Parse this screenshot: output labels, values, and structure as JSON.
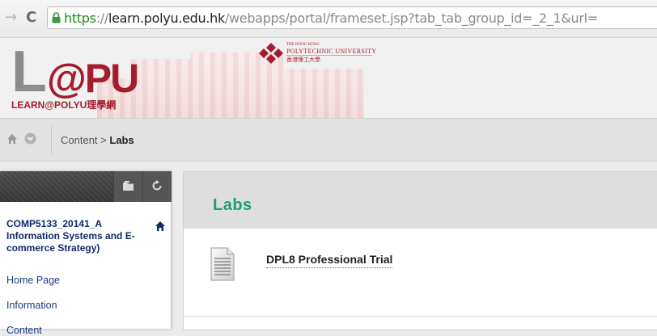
{
  "browser": {
    "back_icon": "arrow-right-icon",
    "reload_icon": "reload-icon",
    "url_scheme": "https",
    "url_scheme_sep": "://",
    "url_host": "learn.polyu.edu.hk",
    "url_path": "/webapps/portal/frameset.jsp?tab_tab_group_id=_2_1&url="
  },
  "banner": {
    "logo_big": "L@PU",
    "logo_sub": "LEARN@POLYU理學網",
    "university_small": "THE HONG KONG",
    "university_name": "POLYTECHNIC UNIVERSITY",
    "university_chinese": "香港理工大學"
  },
  "breadcrumb": {
    "items": [
      "Content",
      "Labs"
    ],
    "separator": ">"
  },
  "menu": {
    "course_title": "COMP5133_20141_A Information Systems and E-commerce Strategy)",
    "links": [
      "Home Page",
      "Information",
      "Content"
    ]
  },
  "content": {
    "title": "Labs",
    "items": [
      {
        "label": "DPL8 Professional Trial",
        "icon": "document-icon"
      }
    ]
  },
  "colors": {
    "accent_title": "#1f9d7a",
    "brand_red": "#a51d2d",
    "link_blue": "#1b3c84"
  }
}
